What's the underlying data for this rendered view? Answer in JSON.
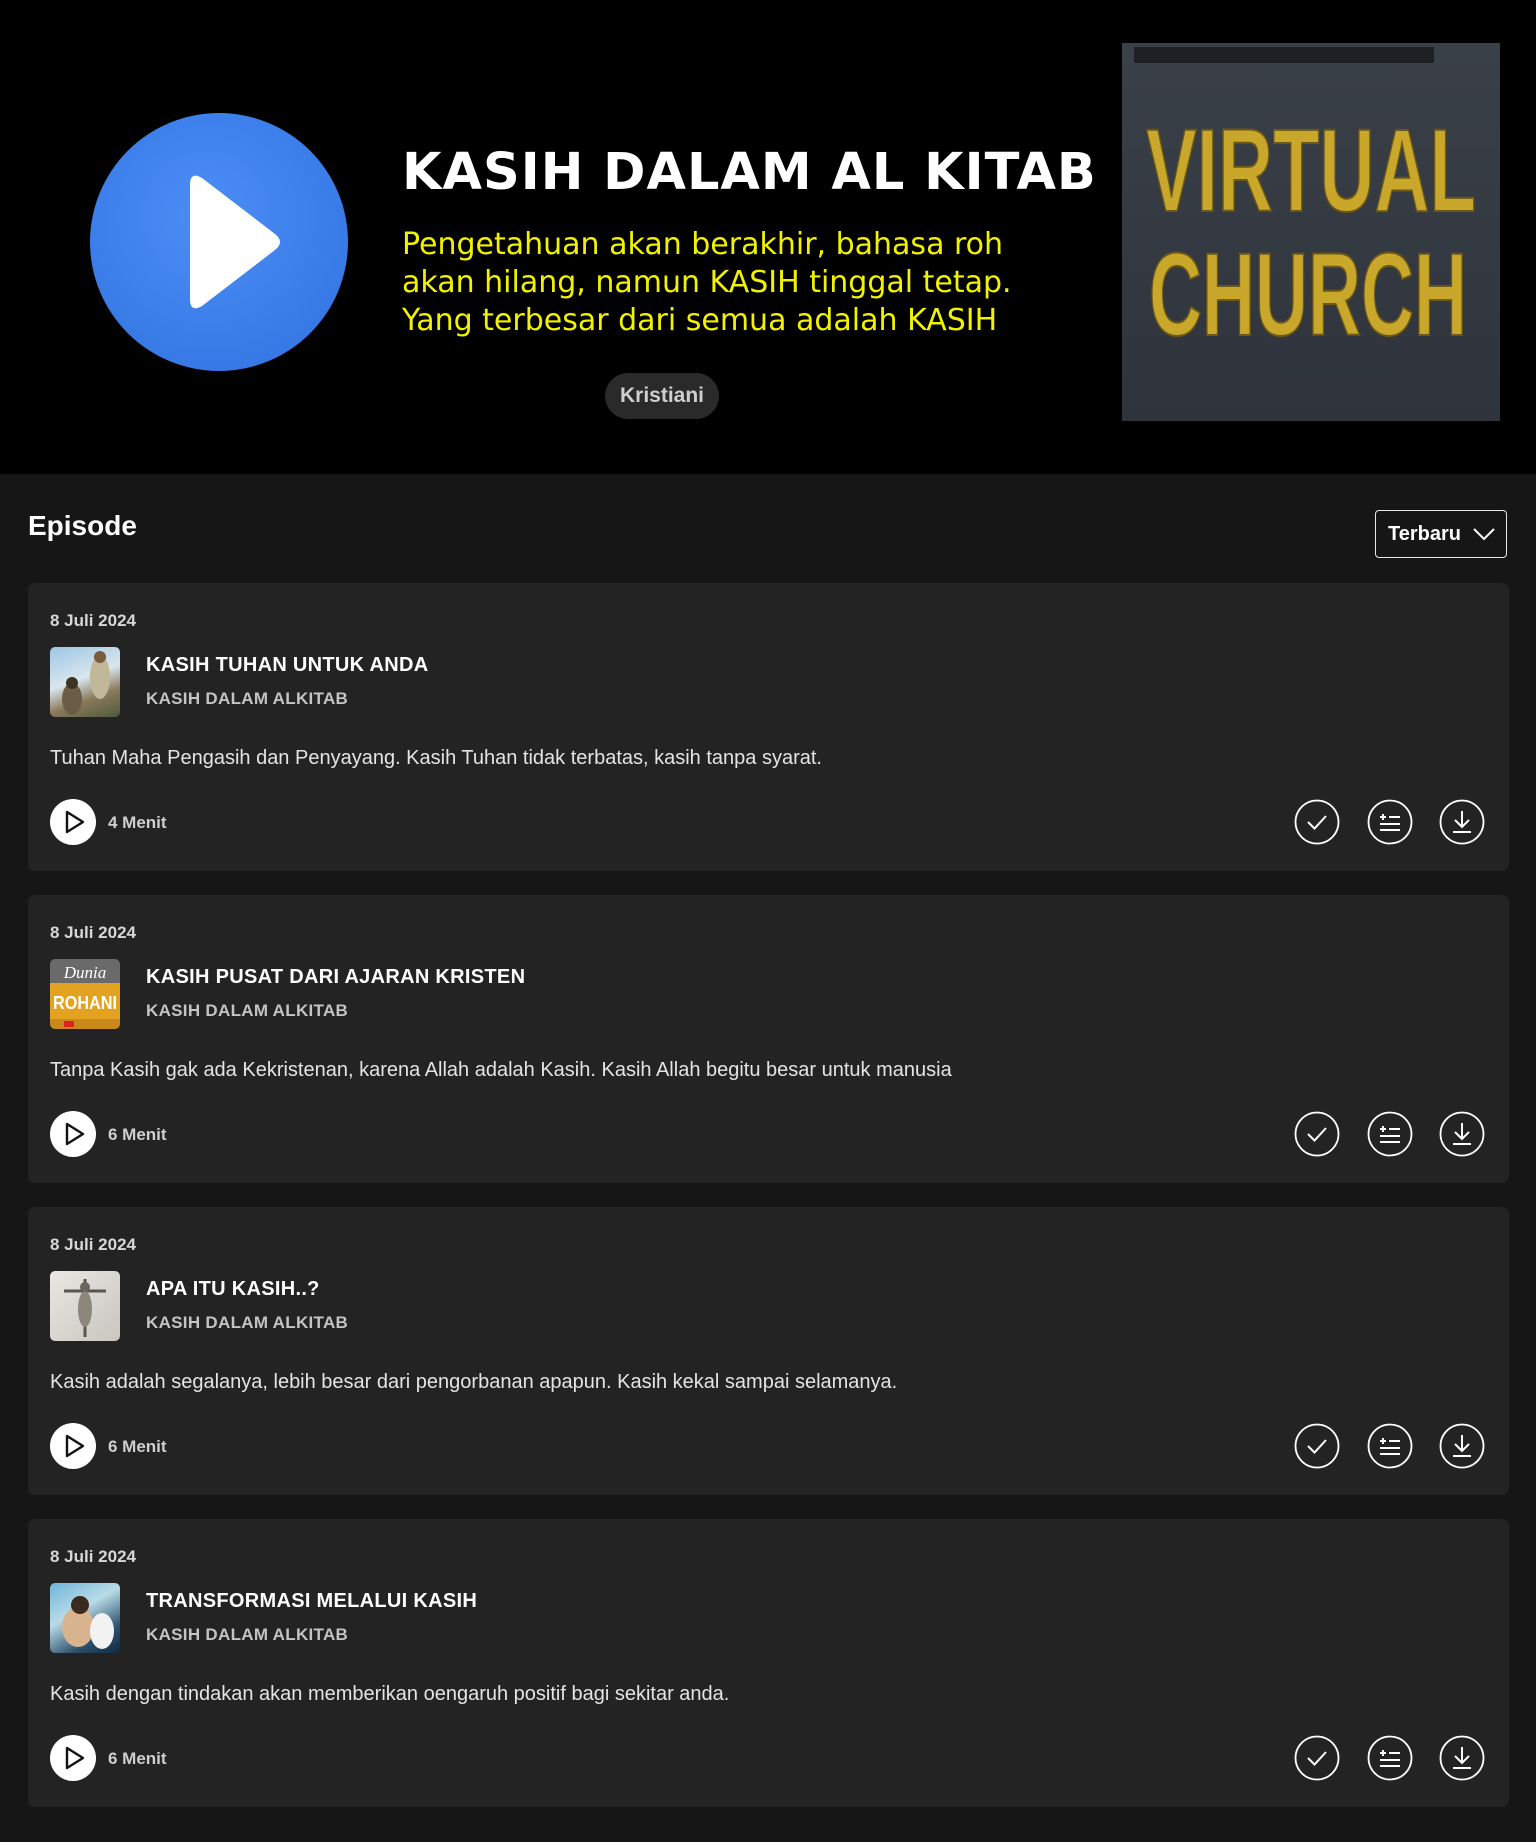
{
  "podcast": {
    "title": "KASIH DALAM AL KITAB",
    "description": "Pengetahuan akan berakhir, bahasa roh akan hilang, namun KASIH tinggal tetap. Yang terbesar dari semua adalah KASIH",
    "category": "Kristiani",
    "cover_text_line1": "VIRTUAL",
    "cover_text_line2": "CHURCH",
    "play_icon": "play-icon",
    "accent_color": "#3a7de9",
    "description_color": "#f2f200"
  },
  "episodes_section": {
    "heading": "Episode",
    "sort_label": "Terbaru",
    "sort_icon": "chevron-down-icon"
  },
  "episodes": [
    {
      "date": "8 Juli 2024",
      "title": "KASIH TUHAN UNTUK ANDA",
      "show": "KASIH DALAM ALKITAB",
      "description": "Tuhan Maha Pengasih dan Penyayang. Kasih Tuhan tidak terbatas, kasih tanpa syarat.",
      "duration": "4 Menit"
    },
    {
      "date": "8 Juli 2024",
      "title": "KASIH PUSAT DARI AJARAN KRISTEN",
      "show": "KASIH DALAM ALKITAB",
      "description": "Tanpa Kasih gak ada Kekristenan, karena Allah adalah Kasih. Kasih Allah begitu besar untuk manusia",
      "duration": "6 Menit",
      "thumb_text1": "Dunia",
      "thumb_text2": "ROHANI"
    },
    {
      "date": "8 Juli 2024",
      "title": "APA ITU KASIH..?",
      "show": "KASIH DALAM ALKITAB",
      "description": "Kasih adalah segalanya, lebih besar dari pengorbanan apapun. Kasih kekal sampai selamanya.",
      "duration": "6 Menit"
    },
    {
      "date": "8 Juli 2024",
      "title": "TRANSFORMASI MELALUI KASIH",
      "show": "KASIH DALAM ALKITAB",
      "description": "Kasih dengan tindakan akan memberikan oengaruh positif bagi sekitar anda.",
      "duration": "6 Menit"
    }
  ],
  "episode_actions": [
    "check-circle-icon",
    "add-to-queue-icon",
    "download-icon"
  ]
}
